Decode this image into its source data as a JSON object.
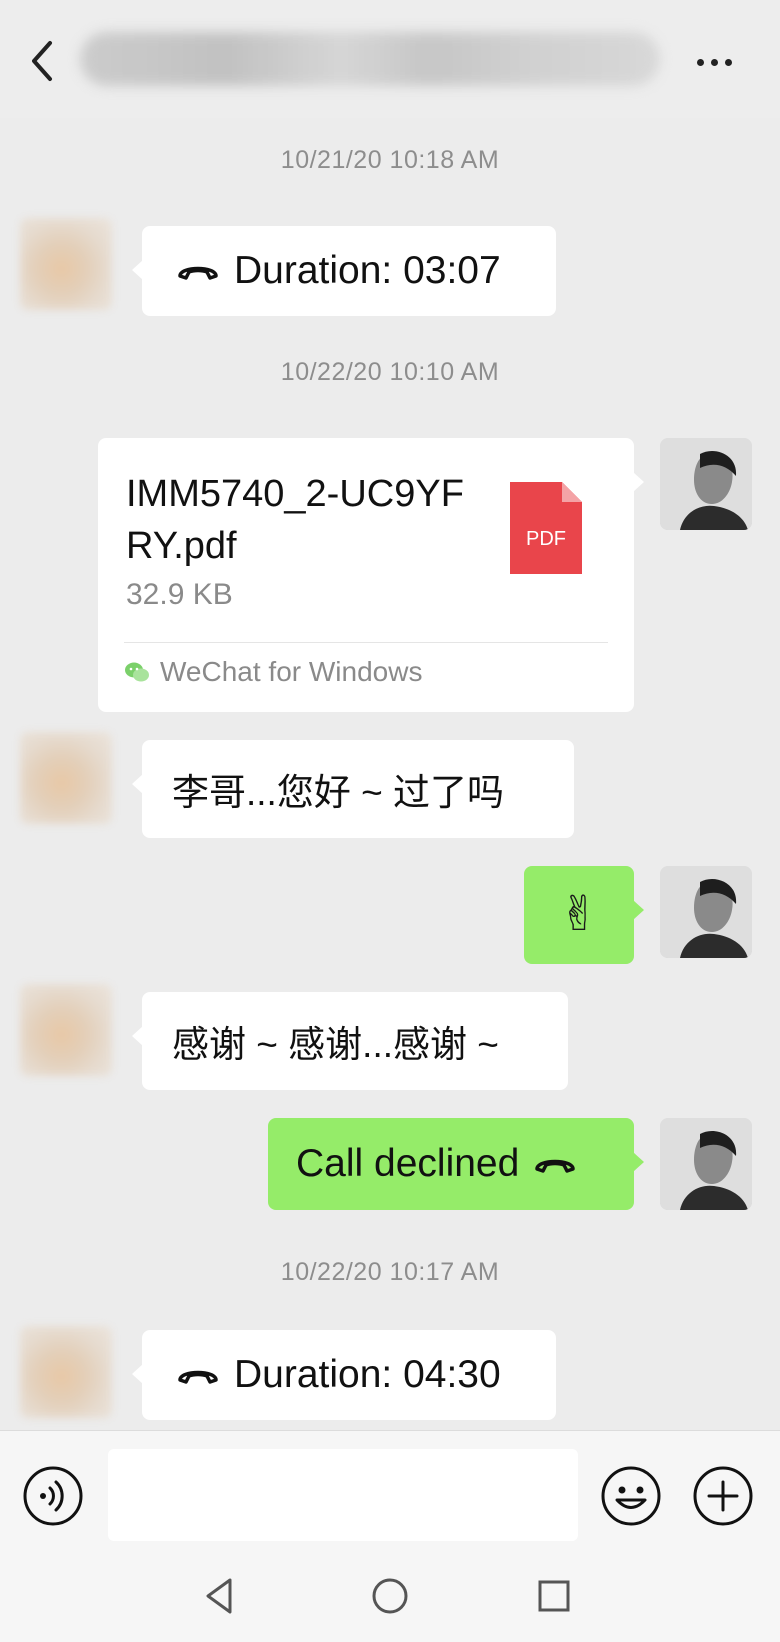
{
  "header": {
    "back_icon": "chevron-left-icon",
    "more_icon": "more-dots-icon"
  },
  "messages": {
    "ts1": "10/21/20 10:18 AM",
    "call1": "Duration: 03:07",
    "ts2": "10/22/20 10:10 AM",
    "file": {
      "name": "IMM5740_2-UC9YFRY.pdf",
      "size": "32.9 KB",
      "badge": "PDF",
      "source": "WeChat for Windows"
    },
    "text1": "李哥...您好 ~ 过了吗",
    "emoji1": "✌",
    "text2": "感谢 ~ 感谢...感谢 ~",
    "call_declined": "Call declined",
    "ts3": "10/22/20 10:17 AM",
    "call2": "Duration: 04:30"
  },
  "input": {
    "placeholder": ""
  },
  "colors": {
    "incoming_bubble": "#ffffff",
    "outgoing_bubble": "#95ec69",
    "pdf_red": "#e9454b",
    "wechat_green": "#2dc100"
  }
}
